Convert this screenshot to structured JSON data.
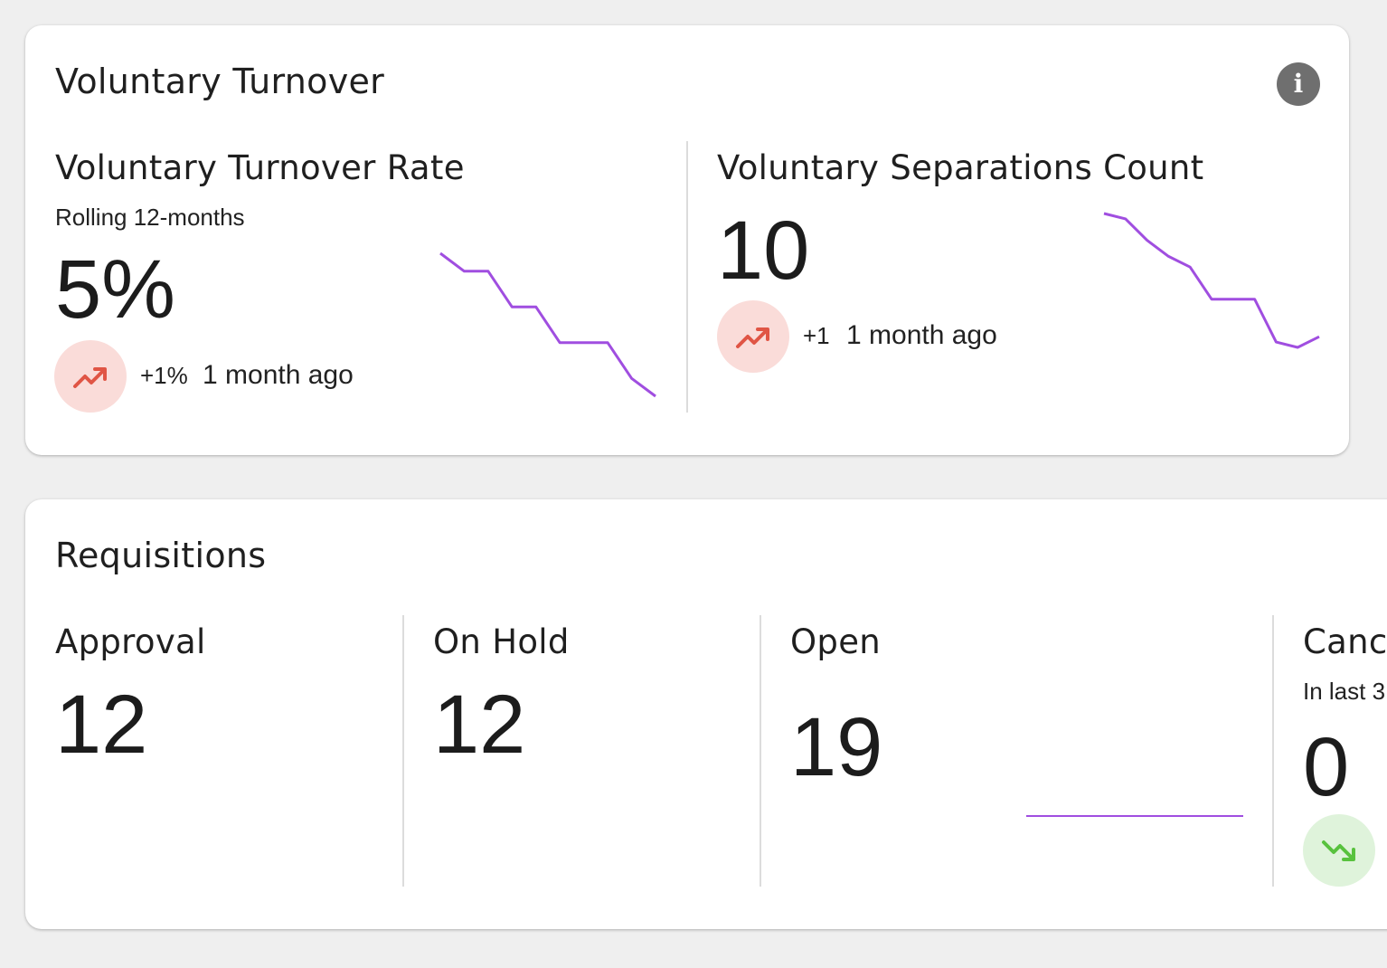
{
  "turnover": {
    "title": "Voluntary Turnover",
    "info_icon": "info-icon",
    "rate": {
      "title": "Voluntary Turnover Rate",
      "subtitle": "Rolling 12-months",
      "value": "5%",
      "trend_icon": "trending-up-icon",
      "delta": "+1%",
      "when": "1 month ago",
      "sparkline": [
        11,
        10,
        10,
        8,
        8,
        6,
        6,
        6,
        4,
        3
      ]
    },
    "separations": {
      "title": "Voluntary Separations Count",
      "value": "10",
      "trend_icon": "trending-up-icon",
      "delta": "+1",
      "when": "1 month ago",
      "sparkline": [
        17,
        16.5,
        14.5,
        13,
        12,
        9,
        9,
        9,
        5,
        4.5,
        5.5
      ]
    }
  },
  "requisitions": {
    "title": "Requisitions",
    "approval": {
      "title": "Approval",
      "value": "12"
    },
    "on_hold": {
      "title": "On Hold",
      "value": "12"
    },
    "open": {
      "title": "Open",
      "value": "19",
      "sparkline": [
        19,
        19
      ]
    },
    "cancelled": {
      "title": "Canc",
      "subtitle": "In last 3",
      "value": "0",
      "trend_icon": "trending-down-icon"
    }
  },
  "colors": {
    "sparkline": "#a04ee0",
    "trend_up": "#e05545",
    "trend_up_bg": "#fadcd9",
    "trend_down": "#58c23e",
    "trend_down_bg": "#dff3db"
  }
}
